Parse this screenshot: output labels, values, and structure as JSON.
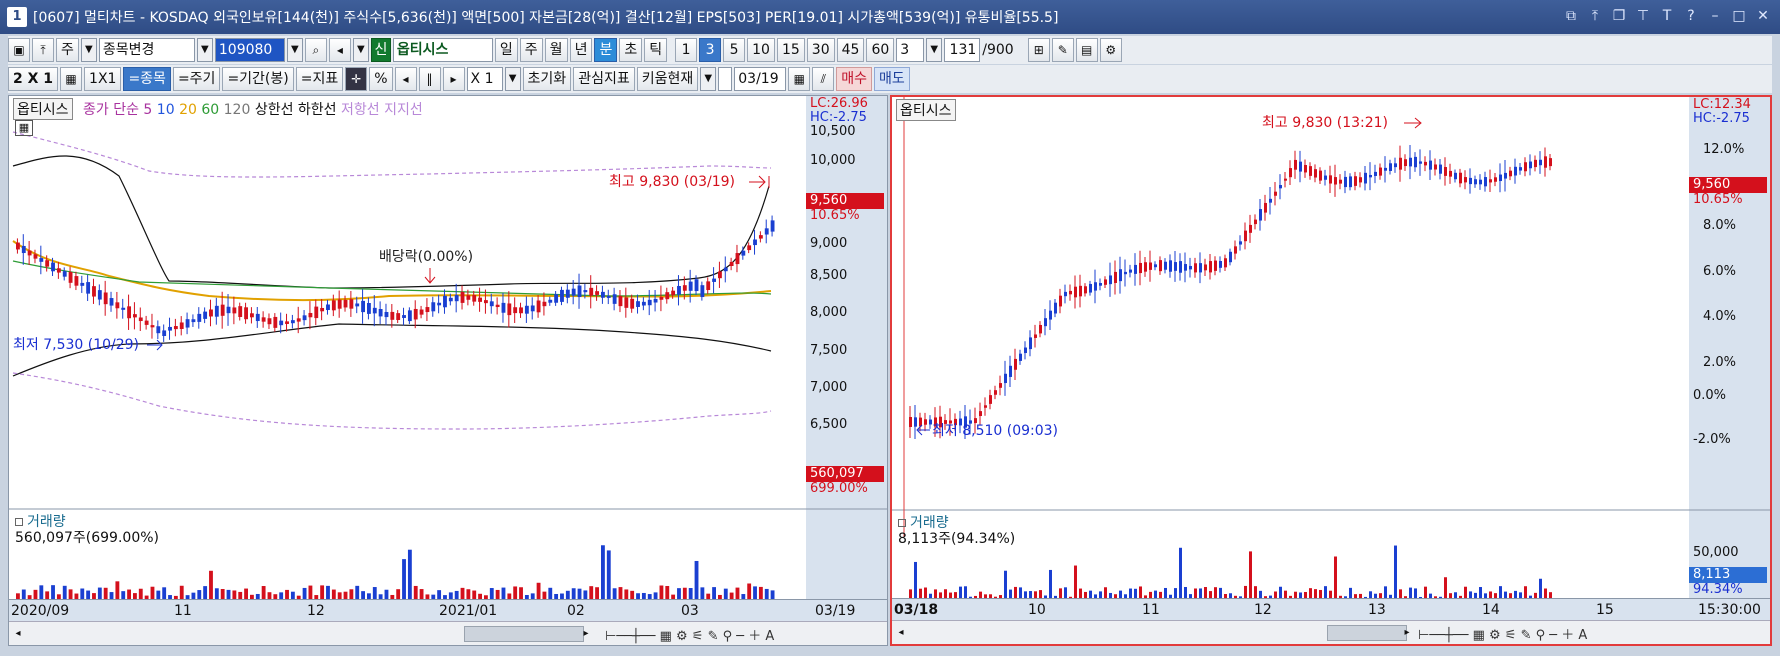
{
  "window": {
    "number": "1",
    "title": "[0607] 멀티차트 - KOSDAQ 외국인보유[144(천)] 주식수[5,636(천)] 액면[500] 자본금[28(억)] 결산[12월] EPS[503] PER[19.01] 시가총액[539(억)] 유통비율[55.5]"
  },
  "toolbar1": {
    "market_label": "주",
    "stock_change": "종목변경",
    "code": "109080",
    "stock_badge": "신",
    "stock_name": "옵티시스",
    "periods": [
      "일",
      "주",
      "월",
      "년",
      "분",
      "초",
      "틱"
    ],
    "active_period": "분",
    "intervals": [
      "1",
      "3",
      "5",
      "10",
      "15",
      "30",
      "45",
      "60"
    ],
    "active_interval": "3",
    "interval_value": "3",
    "count": "131",
    "count_total": "/900"
  },
  "toolbar2": {
    "layout": "2 X 1",
    "layout2": "1X1",
    "stock_btn": "=종목",
    "period_btn": "=주기",
    "range_btn": "=기간(봉)",
    "indicator_btn": "=지표",
    "percent": "%",
    "zoom": "X 1",
    "reset": "초기화",
    "interest": "관심지표",
    "kium": "키움현재",
    "date": "03/19",
    "buy": "매수",
    "sell": "매도"
  },
  "left_panel": {
    "stock": "옵티시스",
    "legend": {
      "close": "종가",
      "simple": "단순",
      "ma": [
        "5",
        "10",
        "20",
        "60",
        "120"
      ],
      "upper": "상한선",
      "lower": "하한선",
      "resistance": "저항선",
      "support": "지지선"
    },
    "lc": "LC:26.96",
    "hc": "HC:-2.75",
    "y_ticks": [
      "10,500",
      "10,000",
      "9,500",
      "9,000",
      "8,500",
      "8,000",
      "7,500",
      "7,000",
      "6,500"
    ],
    "price_tag": "9,560",
    "pct_tag": "10.65%",
    "high_label": "최고 9,830 (03/19)",
    "low_label": "최저 7,530 (10/29)",
    "dividend_label": "배당락(0.00%)",
    "volume_title": "거래량",
    "volume_value": "560,097주(699.00%)",
    "volume_tag": "560,097",
    "volume_pct": "699.00%",
    "x_labels": [
      "2020/09",
      "11",
      "12",
      "2021/01",
      "02",
      "03",
      "03/19"
    ]
  },
  "right_panel": {
    "stock": "옵티시스",
    "lc": "LC:12.34",
    "hc": "HC:-2.75",
    "y_ticks": [
      "12.0%",
      "10.0%",
      "8.0%",
      "6.0%",
      "4.0%",
      "2.0%",
      "0.0%",
      "-2.0%"
    ],
    "price_tag": "9,560",
    "pct_tag": "10.65%",
    "high_label": "최고 9,830 (13:21)",
    "low_label": "최저 8,510 (09:03)",
    "volume_title": "거래량",
    "volume_value": "8,113주(94.34%)",
    "volume_y": "50,000",
    "volume_tag": "8,113",
    "volume_pct": "94.34%",
    "x_labels": [
      "03/18",
      "10",
      "11",
      "12",
      "13",
      "14",
      "15",
      "15:30:00"
    ]
  },
  "colors": {
    "up": "#d4101c",
    "down": "#1a3fd1",
    "panel_bg": "#ffffff",
    "axis_bg": "#d8e2ee"
  }
}
